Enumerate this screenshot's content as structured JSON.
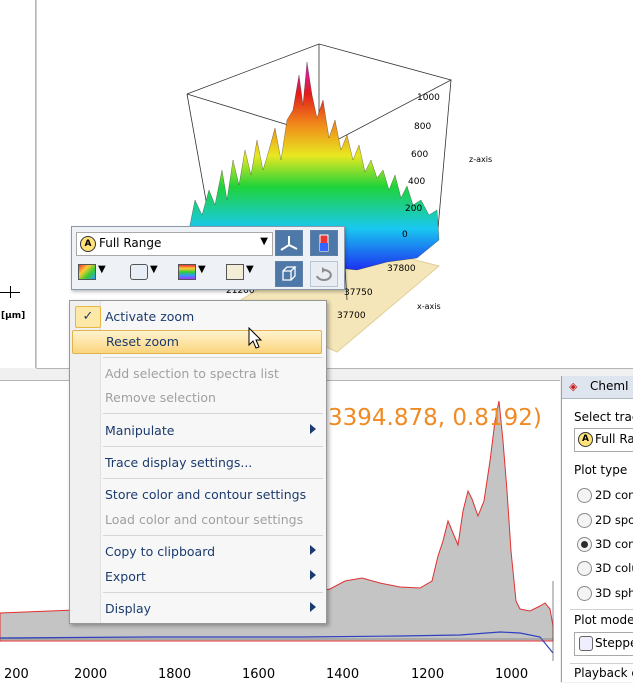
{
  "plot3d": {
    "z_axis_label": "z-axis",
    "x_axis_label": "x-axis",
    "z_ticks": [
      "1000",
      "800",
      "600",
      "400",
      "200",
      "0"
    ],
    "x_ticks": [
      "37800",
      "37750",
      "37700"
    ],
    "y_tick": "21200"
  },
  "left_pane": {
    "unit": "[µm]"
  },
  "toolbar": {
    "range_select": "Full Range",
    "icons": [
      "surface-plot-icon",
      "spot-icon",
      "color-palette-icon",
      "label-icon",
      "axes-icon",
      "colorbar-icon",
      "cube-view-icon",
      "rotate-icon"
    ]
  },
  "context_menu": {
    "items": [
      {
        "label": "Activate zoom",
        "checked": true
      },
      {
        "label": "Reset zoom",
        "hover": true
      },
      {
        "label": "Add selection to spectra list",
        "disabled": true
      },
      {
        "label": "Remove selection",
        "disabled": true
      },
      {
        "label": "Manipulate",
        "submenu": true
      },
      {
        "label": "Trace display settings..."
      },
      {
        "label": "Store color and contour settings"
      },
      {
        "label": "Load color and contour settings",
        "disabled": true
      },
      {
        "label": "Copy to clipboard",
        "submenu": true
      },
      {
        "label": "Export",
        "submenu": true
      },
      {
        "label": "Display",
        "submenu": true
      }
    ],
    "check_mark": "✓"
  },
  "spectrum": {
    "coordinate_readout": "3394.878, 0.8192)",
    "x_ticks": [
      "200",
      "2000",
      "1800",
      "1600",
      "1400",
      "1200",
      "1000"
    ]
  },
  "right_panel": {
    "title": "ChemI",
    "select_trace_label": "Select trac",
    "trace_value": "Full Ran",
    "plot_type_label": "Plot type",
    "plot_types": [
      {
        "label": "2D cont",
        "selected": false
      },
      {
        "label": "2D spot",
        "selected": false
      },
      {
        "label": "3D cont",
        "selected": true
      },
      {
        "label": "3D colu",
        "selected": false
      },
      {
        "label": "3D sphe",
        "selected": false
      }
    ],
    "plot_mode_label": "Plot mode",
    "plot_mode_value": "Steppe",
    "playback_label": "Playback co"
  },
  "colors": {
    "coord_text": "#f08a24",
    "spectrum_fill": "#c4c4c4",
    "red_trace": "#e03030",
    "blue_trace": "#3040c0",
    "menu_text": "#1b3b6e"
  }
}
